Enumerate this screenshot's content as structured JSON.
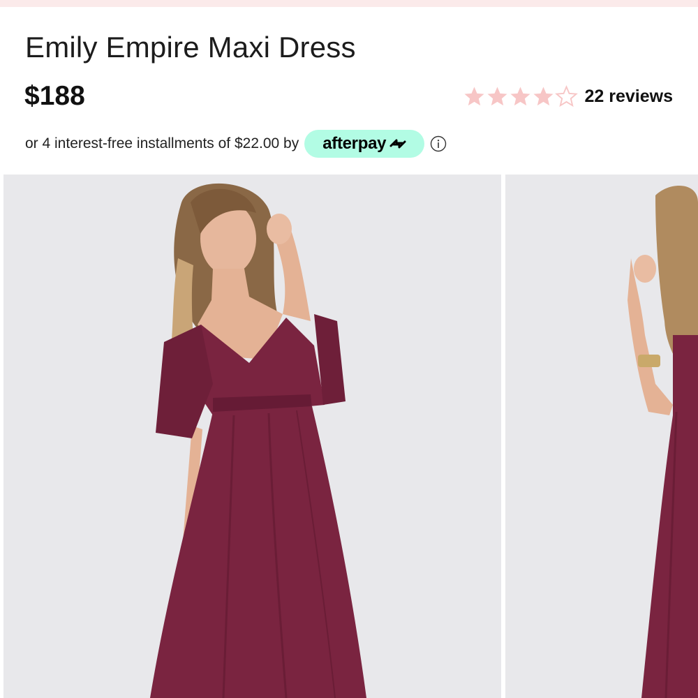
{
  "product": {
    "title": "Emily Empire Maxi Dress",
    "price": "$188",
    "rating": 4,
    "rating_max": 5,
    "reviews_label": "22 reviews"
  },
  "installments": {
    "text": "or 4 interest-free installments of $22.00 by",
    "provider": "afterpay",
    "provider_icon": "afterpay-arrows-icon",
    "info_icon": "info-icon"
  },
  "gallery": {
    "images": [
      {
        "name": "product-photo-front"
      },
      {
        "name": "product-photo-side"
      }
    ]
  },
  "colors": {
    "star_filled": "#f7c6c6",
    "star_empty": "#f7c6c6",
    "afterpay_mint": "#b2fce4",
    "dress": "#7a2440",
    "photo_bg": "#e9e9ec",
    "top_strip": "#fbeaea"
  }
}
